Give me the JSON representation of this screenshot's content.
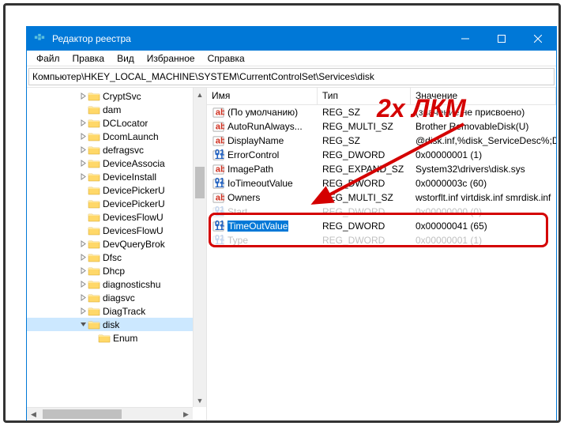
{
  "window": {
    "title": "Редактор реестра"
  },
  "menu": {
    "file": "Файл",
    "edit": "Правка",
    "view": "Вид",
    "favorites": "Избранное",
    "help": "Справка"
  },
  "address": "Компьютер\\HKEY_LOCAL_MACHINE\\SYSTEM\\CurrentControlSet\\Services\\disk",
  "tree": {
    "items": [
      {
        "label": "CryptSvc",
        "indent": 5,
        "toggle": ">"
      },
      {
        "label": "dam",
        "indent": 5,
        "toggle": ""
      },
      {
        "label": "DCLocator",
        "indent": 5,
        "toggle": ">"
      },
      {
        "label": "DcomLaunch",
        "indent": 5,
        "toggle": ">"
      },
      {
        "label": "defragsvc",
        "indent": 5,
        "toggle": ">"
      },
      {
        "label": "DeviceAssocia",
        "indent": 5,
        "toggle": ">"
      },
      {
        "label": "DeviceInstall",
        "indent": 5,
        "toggle": ">"
      },
      {
        "label": "DevicePickerU",
        "indent": 5,
        "toggle": ""
      },
      {
        "label": "DevicePickerU",
        "indent": 5,
        "toggle": ""
      },
      {
        "label": "DevicesFlowU",
        "indent": 5,
        "toggle": ""
      },
      {
        "label": "DevicesFlowU",
        "indent": 5,
        "toggle": ""
      },
      {
        "label": "DevQueryBrok",
        "indent": 5,
        "toggle": ">"
      },
      {
        "label": "Dfsc",
        "indent": 5,
        "toggle": ">"
      },
      {
        "label": "Dhcp",
        "indent": 5,
        "toggle": ">"
      },
      {
        "label": "diagnosticshu",
        "indent": 5,
        "toggle": ">"
      },
      {
        "label": "diagsvc",
        "indent": 5,
        "toggle": ">"
      },
      {
        "label": "DiagTrack",
        "indent": 5,
        "toggle": ">"
      },
      {
        "label": "disk",
        "indent": 5,
        "toggle": "v",
        "selected": true
      },
      {
        "label": "Enum",
        "indent": 6,
        "toggle": ""
      }
    ]
  },
  "list": {
    "columns": {
      "name": "Имя",
      "type": "Тип",
      "value": "Значение"
    },
    "rows": [
      {
        "icon": "sz",
        "name": "(По умолчанию)",
        "type": "REG_SZ",
        "value": "(значение не присвоено)"
      },
      {
        "icon": "sz",
        "name": "AutoRunAlways...",
        "type": "REG_MULTI_SZ",
        "value": "Brother RemovableDisk(U)"
      },
      {
        "icon": "sz",
        "name": "DisplayName",
        "type": "REG_SZ",
        "value": "@disk.inf,%disk_ServiceDesc%;Dis"
      },
      {
        "icon": "bin",
        "name": "ErrorControl",
        "type": "REG_DWORD",
        "value": "0x00000001 (1)"
      },
      {
        "icon": "sz",
        "name": "ImagePath",
        "type": "REG_EXPAND_SZ",
        "value": "System32\\drivers\\disk.sys"
      },
      {
        "icon": "bin",
        "name": "IoTimeoutValue",
        "type": "REG_DWORD",
        "value": "0x0000003c (60)"
      },
      {
        "icon": "sz",
        "name": "Owners",
        "type": "REG_MULTI_SZ",
        "value": "wstorflt.inf virtdisk.inf smrdisk.inf"
      },
      {
        "icon": "bin",
        "name": "Start",
        "type": "REG_DWORD",
        "value": "0x00000000 (0)",
        "hidden": true
      },
      {
        "icon": "bin",
        "name": "TimeOutValue",
        "type": "REG_DWORD",
        "value": "0x00000041 (65)",
        "selected": true
      },
      {
        "icon": "bin",
        "name": "Type",
        "type": "REG_DWORD",
        "value": "0x00000001 (1)",
        "hidden": true
      }
    ]
  },
  "annotation": {
    "text": "2х ЛКМ"
  }
}
